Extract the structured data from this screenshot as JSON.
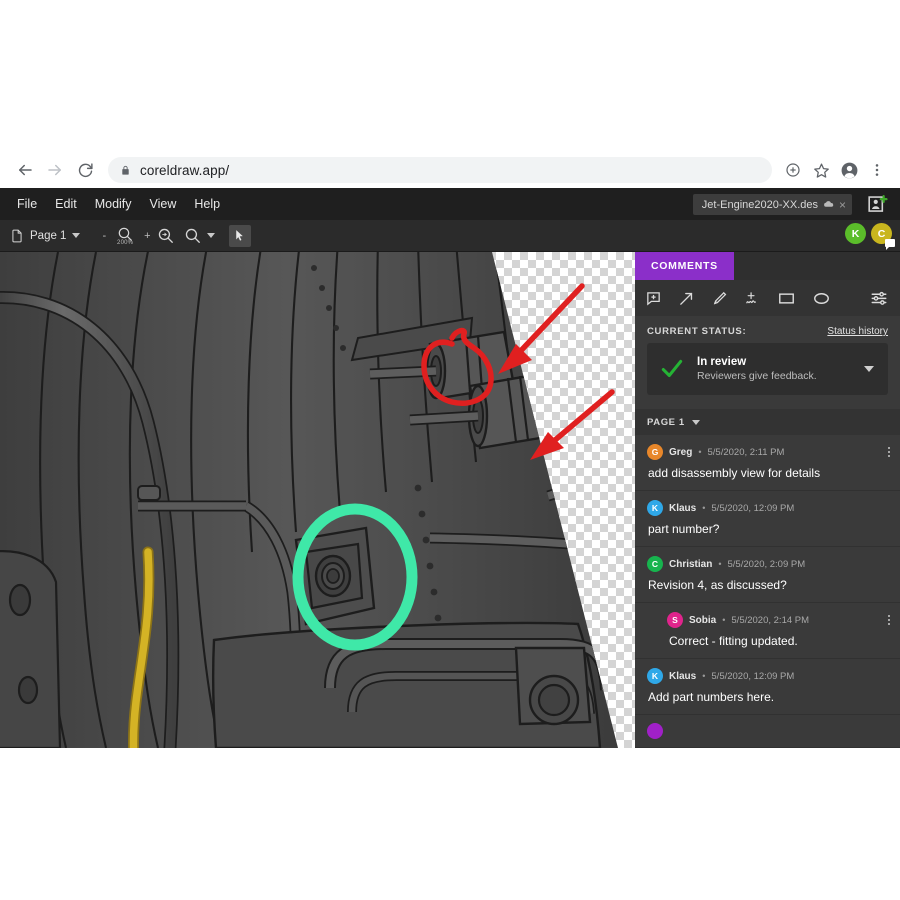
{
  "browser": {
    "back_icon": "back-arrow-icon",
    "forward_icon": "forward-arrow-icon",
    "reload_icon": "reload-icon",
    "lock_icon": "lock-icon",
    "url": "coreldraw.app/",
    "install_icon": "install-app-icon",
    "bookmark_icon": "star-icon",
    "profile_icon": "profile-avatar-icon",
    "menu_icon": "three-dot-menu-icon"
  },
  "menubar": {
    "items": [
      {
        "label": "File"
      },
      {
        "label": "Edit"
      },
      {
        "label": "Modify"
      },
      {
        "label": "View"
      },
      {
        "label": "Help"
      }
    ],
    "document_chip": {
      "name": "Jet-Engine2020-XX.des",
      "cloud_icon": "cloud-saved-icon",
      "close_label": "×"
    },
    "share_icon": "add-collaborator-icon"
  },
  "toolbar": {
    "page_icon": "page-icon",
    "page_label": "Page 1",
    "page_dropdown_icon": "chevron-down-icon",
    "zoom_out_label": "-",
    "zoom_level": "200%",
    "zoom_icon": "magnifier-icon",
    "zoom_in_label": "+",
    "zoom_fit_icon": "zoom-fit-icon",
    "zoom_tool_icon": "magnifier-icon",
    "zoom_dropdown_icon": "chevron-down-icon",
    "select_tool_icon": "pointer-cursor-icon",
    "avatars": [
      {
        "initial": "K",
        "color": "#5bbd2a",
        "badge": false
      },
      {
        "initial": "C",
        "color": "#c9b61e",
        "badge": true
      }
    ]
  },
  "canvas": {
    "artwork_title": "jet-engine-technical-illustration",
    "annotations": [
      {
        "type": "freehand-circle",
        "color": "#e02020"
      },
      {
        "type": "arrow",
        "color": "#e02020"
      },
      {
        "type": "arrow",
        "color": "#e02020"
      },
      {
        "type": "ellipse",
        "color": "#3fe8a8"
      }
    ],
    "cable_color": "#d4b325"
  },
  "panel": {
    "tab_label": "COMMENTS",
    "tab_color": "#8b2fc9",
    "annotation_tools": [
      {
        "name": "add-comment-icon"
      },
      {
        "name": "arrow-tool-icon"
      },
      {
        "name": "pen-tool-icon"
      },
      {
        "name": "freehand-tool-icon"
      },
      {
        "name": "rectangle-tool-icon"
      },
      {
        "name": "ellipse-tool-icon"
      },
      {
        "name": "settings-sliders-icon"
      }
    ],
    "status": {
      "label": "CURRENT STATUS:",
      "history_link": "Status history",
      "check_icon": "green-check-icon",
      "title": "In review",
      "subtitle": "Reviewers give feedback.",
      "dropdown_icon": "chevron-down-icon"
    },
    "page_selector": {
      "label": "PAGE 1",
      "dropdown_icon": "chevron-down-icon"
    },
    "comments": [
      {
        "author": "Greg",
        "initial": "G",
        "color": "#e8872a",
        "separator": "•",
        "time": "5/5/2020, 2:11 PM",
        "body": "add disassembly view for details",
        "reply": false,
        "menu": true
      },
      {
        "author": "Klaus",
        "initial": "K",
        "color": "#2fa8e8",
        "separator": "•",
        "time": "5/5/2020, 12:09 PM",
        "body": "part number?",
        "reply": false,
        "menu": false
      },
      {
        "author": "Christian",
        "initial": "C",
        "color": "#17b44e",
        "separator": "•",
        "time": "5/5/2020, 2:09 PM",
        "body": "Revision 4, as discussed?",
        "reply": false,
        "menu": false
      },
      {
        "author": "Sobia",
        "initial": "S",
        "color": "#e0248c",
        "separator": "•",
        "time": "5/5/2020, 2:14 PM",
        "body": "Correct - fitting updated.",
        "reply": true,
        "menu": true
      },
      {
        "author": "Klaus",
        "initial": "K",
        "color": "#2fa8e8",
        "separator": "•",
        "time": "5/5/2020, 12:09 PM",
        "body": "Add part numbers here.",
        "reply": false,
        "menu": false
      }
    ],
    "partial_comment": {
      "initial": "",
      "color": "#a020c8"
    }
  }
}
